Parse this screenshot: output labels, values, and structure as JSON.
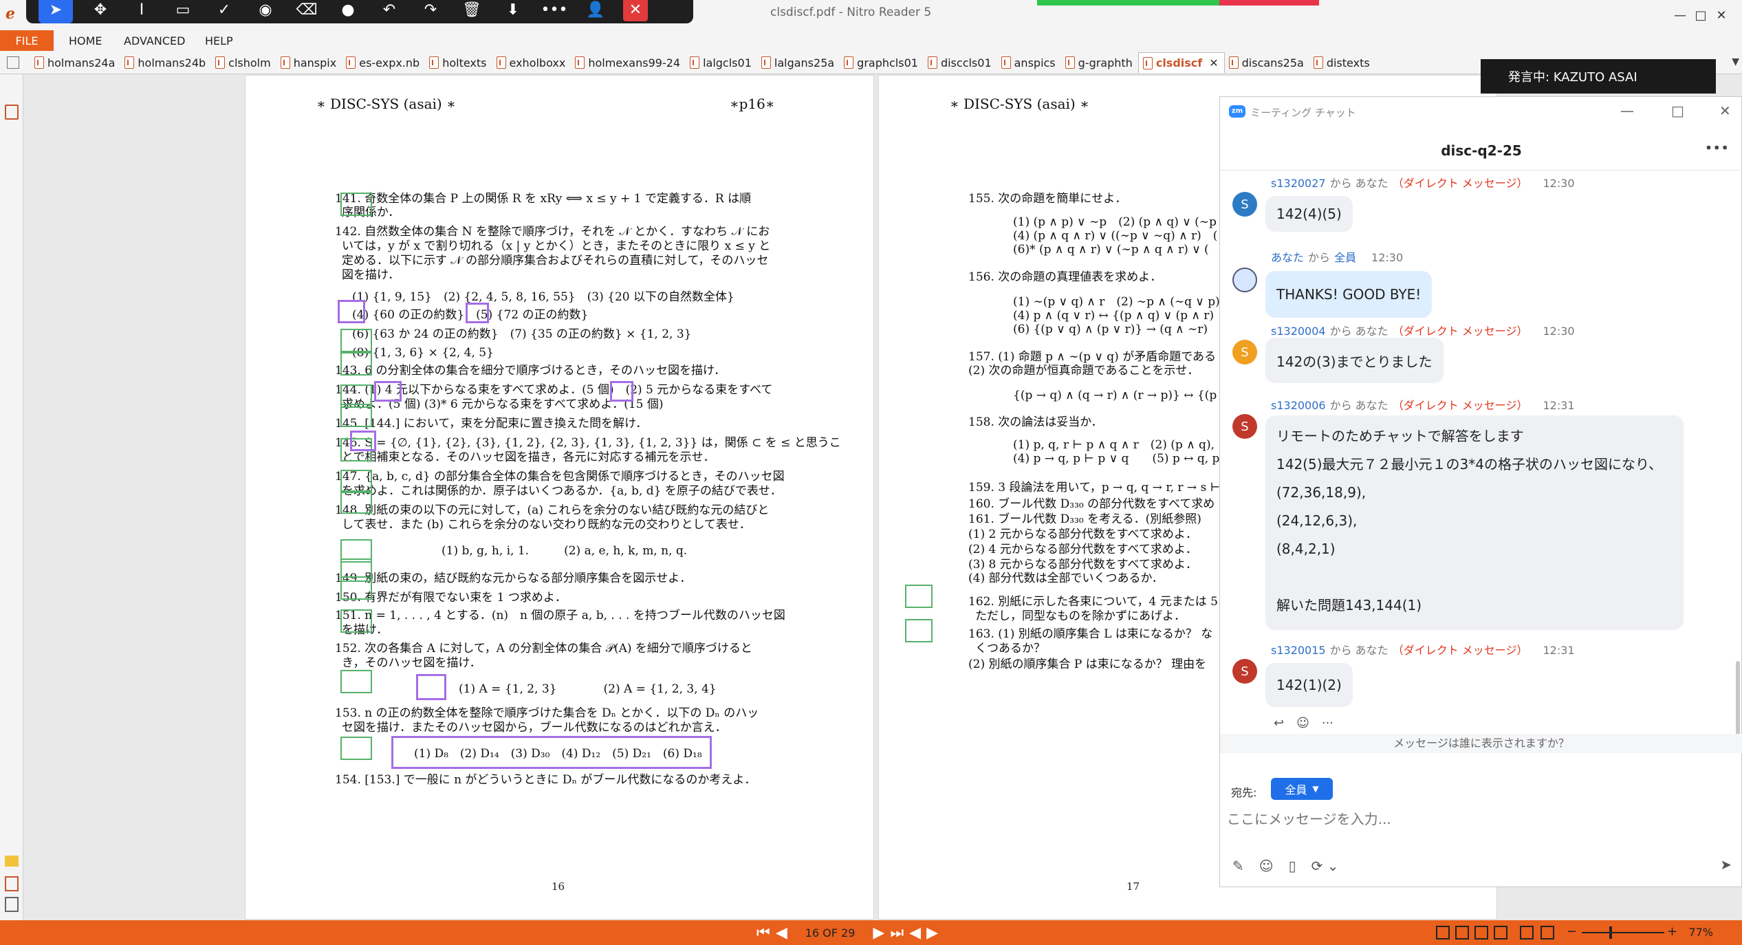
{
  "window": {
    "title": "clsdiscf.pdf - Nitro Reader 5",
    "min": "—",
    "max": "□",
    "close": "✕"
  },
  "annotate_toolbar": {
    "tools": [
      "pointer-icon",
      "move-icon",
      "text-cursor-icon",
      "rectangle-icon",
      "check-icon",
      "spotlight-icon",
      "eraser-icon",
      "color-icon",
      "undo-icon",
      "redo-icon",
      "delete-icon",
      "save-icon",
      "more-icon",
      "account-icon"
    ],
    "close": "✕",
    "glyphs": [
      "➤",
      "✥",
      "I",
      "▭",
      "✓",
      "◉",
      "⌫",
      "●",
      "↶",
      "↷",
      "🗑",
      "⬇",
      "•••",
      "👤"
    ]
  },
  "menu": {
    "file": "FILE",
    "home": "HOME",
    "advanced": "ADVANCED",
    "help": "HELP"
  },
  "tabs": [
    "holmans24a",
    "holmans24b",
    "clsholm",
    "hanspix",
    "es-expx.nb",
    "holtexts",
    "exholboxx",
    "holmexans99-24",
    "lalgcls01",
    "lalgans25a",
    "graphcls01",
    "disccls01",
    "anspics",
    "g-graphth",
    "clsdiscf",
    "discans25a",
    "distexts"
  ],
  "active_tab": "clsdiscf",
  "speaking": "発言中: KAZUTO ASAI",
  "left_page": {
    "header_left": "∗ DISC-SYS (asai) ∗",
    "header_right": "∗p16∗",
    "lines": [
      "141. 奇数全体の集合 P 上の関係 R を xRy ⟺ x ≤ y + 1 で定義する．R は順",
      "序関係か．",
      "142. 自然数全体の集合 N を整除で順序づけ，それを 𝒩 とかく．すなわち 𝒩 にお",
      "いては，y が x で割り切れる（x | y とかく）とき，またそのときに限り x ≤ y と",
      "定める．以下に示す 𝒩 の部分順序集合およびそれらの直積に対して，そのハッセ",
      "図を描け．",
      "(1) {1, 9, 15}　(2) {2, 4, 5, 8, 16, 55}　(3) {20 以下の自然数全体}",
      "(4) {60 の正の約数}　(5) {72 の正の約数}",
      "(6) {63 か 24 の正の約数}　(7) {35 の正の約数} × {1, 2, 3}",
      "(8) {1, 3, 6} × {2, 4, 5}",
      "143. 6 の分割全体の集合を細分で順序づけるとき，そのハッセ図を描け．",
      "144. (1) 4 元以下からなる束をすべて求めよ．(5 個)　(2) 5 元からなる束をすべて",
      "求めよ．(5 個) (3)* 6 元からなる束をすべて求めよ．(15 個)",
      "145. [144.] において，束を分配束に置き換えた問を解け．",
      "146. S = {∅, {1}, {2}, {3}, {1, 2}, {2, 3}, {1, 3}, {1, 2, 3}} は，関係 ⊂ を ≤ と思うこ",
      "とで相補束となる．そのハッセ図を描き，各元に対応する補元を示せ．",
      "147. {a, b, c, d} の部分集合全体の集合を包含関係で順序づけるとき，そのハッセ図",
      "を求めよ．これは関係的か．原子はいくつあるか．{a, b, d} を原子の結びで表せ．",
      "148. 別紙の束の以下の元に対して，(a) これらを余分のない結び既約な元の結びと",
      "して表せ．また (b) これらを余分のない交わり既約な元の交わりとして表せ．",
      "(1) b, g, h, i, 1.　　　(2) a, e, h, k, m, n, q.",
      "149. 別紙の束の，結び既約な元からなる部分順序集合を図示せよ．",
      "150. 有界だが有限でない束を 1 つ求めよ．",
      "151. n = 1, . . . , 4 とする．(n)　n 個の原子 a, b, . . . を持つブール代数のハッセ図",
      "を描け．",
      "152. 次の各集合 A に対して，A の分割全体の集合 𝒫(A) を細分で順序づけると",
      "き，そのハッセ図を描け．",
      "(1) A = {1, 2, 3}　　　　(2) A = {1, 2, 3, 4}",
      "153. n の正の約数全体を整除で順序づけた集合を Dₙ とかく．以下の Dₙ のハッ",
      "セ図を描け．またそのハッセ図から，ブール代数になるのはどれか言え．",
      "(1) D₈　(2) D₁₄　(3) D₃₀　(4) D₁₂　(5) D₂₁　(6) D₁₈",
      "154. [153.] で一般に n がどういうときに Dₙ がブール代数になるのか考えよ．"
    ],
    "page_number": "16"
  },
  "right_page": {
    "header_left": "∗ DISC-SYS (asai) ∗",
    "lines": [
      "155. 次の命題を簡単にせよ．",
      "(1) (p ∧ p) ∨ ∼p　(2) (p ∧ q) ∨ (∼p",
      "(4) (p ∧ q ∧ r) ∨ ((∼p ∨ ∼q) ∧ r)　(",
      "(6)* (p ∧ q ∧ r) ∨ (∼p ∧ q ∧ r) ∨ (",
      "156. 次の命題の真理値表を求めよ．",
      "(1) ∼(p ∨ q) ∧ r　(2) ∼p ∧ (∼q ∨ p)",
      "(4) p ∧ (q ∨ r) ↔ {(p ∧ q) ∨ (p ∧ r)",
      "(6) {(p ∨ q) ∧ (p ∨ r)} → (q ∧ ∼r)　(7",
      "157. (1) 命題 p ∧ ∼(p ∨ q) が矛盾命題である",
      "(2) 次の命題が恒真命題であることを示せ．",
      "{(p → q) ∧ (q → r) ∧ (r → p)} ↔ {(p",
      "158. 次の論法は妥当か．",
      "(1) p, q, r ⊢ p ∧ q ∧ r　(2) (p ∧ q),",
      "(4) p → q, p ⊢ p ∨ q　　(5) p ↔ q, p",
      "159. 3 段論法を用いて，p → q, q → r, r → s ⊢",
      "160. ブール代数 D₃₃₀ の部分代数をすべて求め",
      "161. ブール代数 D₃₃₀ を考える．(別紙参照)",
      "(1) 2 元からなる部分代数をすべて求めよ．",
      "(2) 4 元からなる部分代数をすべて求めよ．",
      "(3) 8 元からなる部分代数をすべて求めよ．",
      "(4) 部分代数は全部でいくつあるか．",
      "162. 別紙に示した各束について，4 元または 5",
      "ただし，同型なものを除かずにあげよ．",
      "163. (1) 別紙の順序集合 L は束になるか？ な",
      "くつあるか？",
      "(2) 別紙の順序集合 P は束になるか？ 理由を"
    ],
    "page_number": "17"
  },
  "chat": {
    "window_title": "ミーティング チャット",
    "title": "disc-q2-25",
    "messages": [
      {
        "sender": "s1320027",
        "mid": "から あなた",
        "dm": "（ダイレクト メッセージ）",
        "time": "12:30",
        "text": "142(4)(5)",
        "avatar": "S",
        "color": "#2d7bc4"
      },
      {
        "sender": "あなた",
        "mid": "から",
        "to": "全員",
        "time": "12:30",
        "text": "THANKS! GOOD BYE!"
      },
      {
        "sender": "s1320004",
        "mid": "から あなた",
        "dm": "（ダイレクト メッセージ）",
        "time": "12:30",
        "text": "142の(3)までとりました",
        "avatar": "S",
        "color": "#f0a020"
      },
      {
        "sender": "s1320006",
        "mid": "から あなた",
        "dm": "（ダイレクト メッセージ）",
        "time": "12:31",
        "lines": [
          "リモートのためチャットで解答をします",
          "142(5)最大元７２最小元１の3*4の格子状のハッセ図になり、",
          "(72,36,18,9),",
          "(24,12,6,3),",
          "(8,4,2,1)",
          "",
          "解いた問題143,144(1)"
        ],
        "avatar": "S",
        "color": "#c0392b"
      },
      {
        "sender": "s1320015",
        "mid": "から あなた",
        "dm": "（ダイレクト メッセージ）",
        "time": "12:31",
        "text": "142(1)(2)",
        "avatar": "S",
        "color": "#c0392b"
      }
    ],
    "who_sees": "メッセージは誰に表示されますか？",
    "to_label": "宛先:",
    "to_value": "全員",
    "input_placeholder": "ここにメッセージを入力..."
  },
  "status": {
    "page": "16 OF 29",
    "zoom": "77%"
  }
}
